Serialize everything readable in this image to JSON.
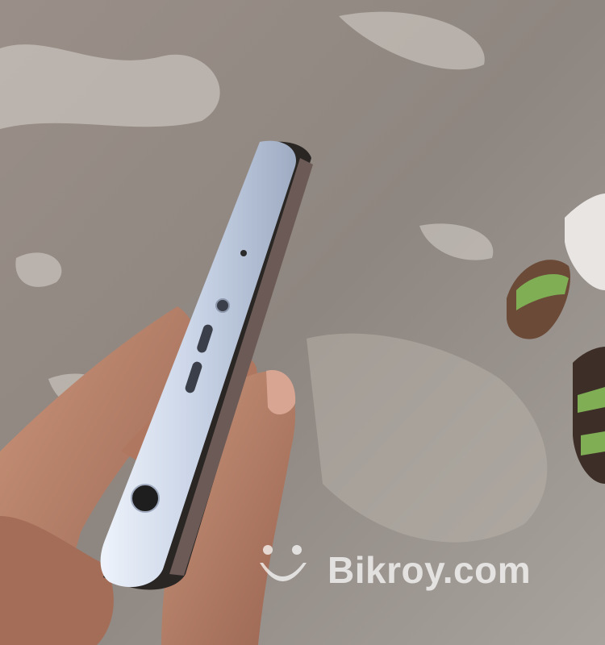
{
  "image": {
    "subject": "phone-top-edge-held-in-hand",
    "colors": {
      "ground": "#8f8983",
      "phone_frame": "#c8d3e6",
      "skin": "#b77d66",
      "sandal_strap": "#7fae55"
    }
  },
  "watermark": {
    "text": "Bikroy.com",
    "color": "#ffffff"
  }
}
